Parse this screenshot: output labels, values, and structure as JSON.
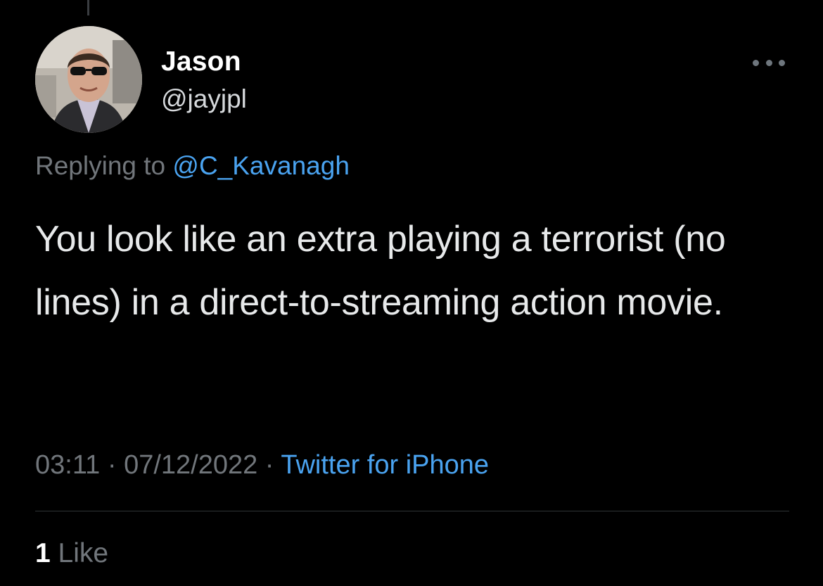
{
  "tweet": {
    "author": {
      "display_name": "Jason",
      "handle": "@jayjpl",
      "avatar_icon": "profile-photo"
    },
    "reply": {
      "prefix": "Replying to ",
      "mention": "@C_Kavanagh"
    },
    "text": "You look like an extra playing a terrorist (no lines) in a direct-to-streaming action movie.",
    "time": "03:11",
    "separator": " · ",
    "date": "07/12/2022",
    "source": "Twitter for iPhone",
    "likes": {
      "count": "1",
      "label": "Like"
    },
    "more_icon": "more-horizontal-icon"
  },
  "colors": {
    "background": "#000000",
    "primary_text": "#e7e9ea",
    "secondary_text": "#71767b",
    "link": "#4aa3f0",
    "divider": "#2f3336"
  }
}
